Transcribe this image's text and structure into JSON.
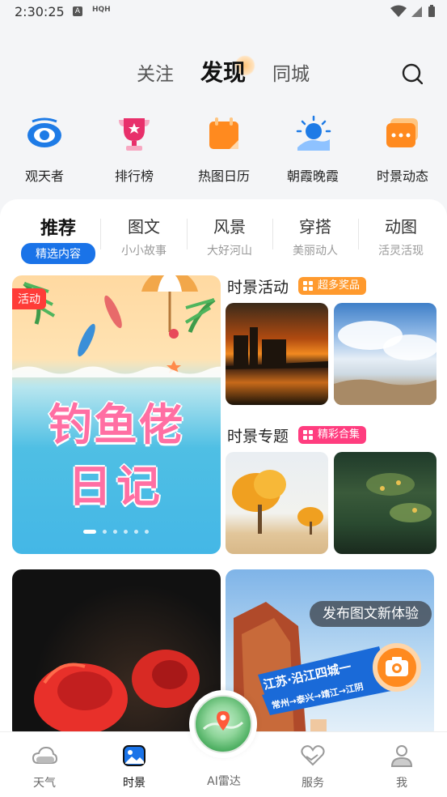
{
  "status": {
    "time": "2:30:25",
    "icon_a": "A",
    "icon_text": "HQH"
  },
  "top_tabs": [
    {
      "label": "关注"
    },
    {
      "label": "发现"
    },
    {
      "label": "同城"
    }
  ],
  "shortcuts": [
    {
      "label": "观天者",
      "icon": "eye-icon",
      "color": "#1e7be6"
    },
    {
      "label": "排行榜",
      "icon": "trophy-icon",
      "color": "#e8306b"
    },
    {
      "label": "热图日历",
      "icon": "calendar-icon",
      "color": "#ff8a1f"
    },
    {
      "label": "朝霞晚霞",
      "icon": "sunrise-icon",
      "color": "#1e7be6"
    },
    {
      "label": "时景动态",
      "icon": "chat-icon",
      "color": "#ff8a1f"
    }
  ],
  "categories": [
    {
      "title": "推荐",
      "sub": "精选内容"
    },
    {
      "title": "图文",
      "sub": "小小故事"
    },
    {
      "title": "风景",
      "sub": "大好河山"
    },
    {
      "title": "穿搭",
      "sub": "美丽动人"
    },
    {
      "title": "动图",
      "sub": "活灵活现"
    }
  ],
  "feature": {
    "badge": "活动",
    "title_line1": "钓鱼佬",
    "title_line2": "日记"
  },
  "activity": {
    "title": "时景活动",
    "tag": "超多奖品",
    "tag_color": "#ff9a2e"
  },
  "topic": {
    "title": "时景专题",
    "tag": "精彩合集",
    "tag_color": "#ff3d7f"
  },
  "promo": {
    "bubble": "发布图文新体验",
    "banner_line1": "江苏·沿江四城一",
    "banner_line2": "常州→泰兴→靖江→江阴"
  },
  "bottom_nav": [
    {
      "label": "天气",
      "icon": "cloud-icon"
    },
    {
      "label": "时景",
      "icon": "picture-icon"
    },
    {
      "label": "AI雷达",
      "icon": "radar-icon"
    },
    {
      "label": "服务",
      "icon": "heart-hand-icon"
    },
    {
      "label": "我",
      "icon": "user-icon"
    }
  ]
}
